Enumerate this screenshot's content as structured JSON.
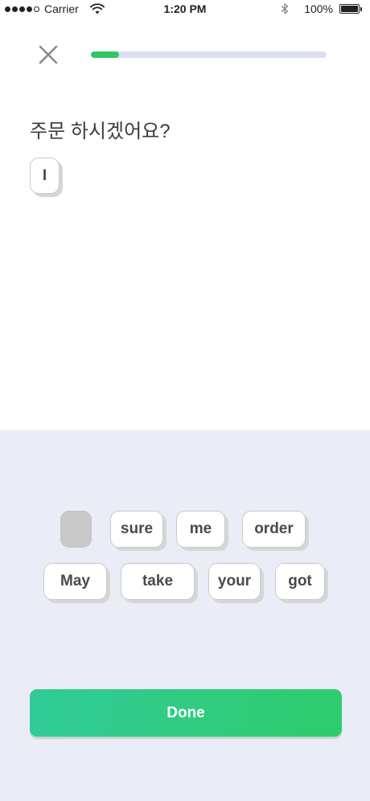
{
  "status_bar": {
    "carrier": "Carrier",
    "time": "1:20 PM",
    "battery": "100%"
  },
  "lesson": {
    "progress": 0.12,
    "prompt": "주문 하시겠어요?"
  },
  "answer": {
    "chips": [
      {
        "label": "I"
      }
    ]
  },
  "word_bank": {
    "chips": [
      {
        "label": "",
        "used": true
      },
      {
        "label": "sure",
        "used": false
      },
      {
        "label": "me",
        "used": false
      },
      {
        "label": "order",
        "used": false
      },
      {
        "label": "May",
        "used": false
      },
      {
        "label": "take",
        "used": false
      },
      {
        "label": "your",
        "used": false
      },
      {
        "label": "got",
        "used": false
      }
    ]
  },
  "actions": {
    "done_label": "Done"
  },
  "colors": {
    "accent_green": "#2dc765",
    "progress_track": "#dcdff3",
    "bank_background": "#ebedf6",
    "chip_used": "#c9c9c9"
  },
  "icons": {
    "close": "close-icon",
    "wifi": "wifi-icon",
    "bluetooth": "bluetooth-icon",
    "battery": "battery-icon",
    "signal": "signal-icon"
  }
}
